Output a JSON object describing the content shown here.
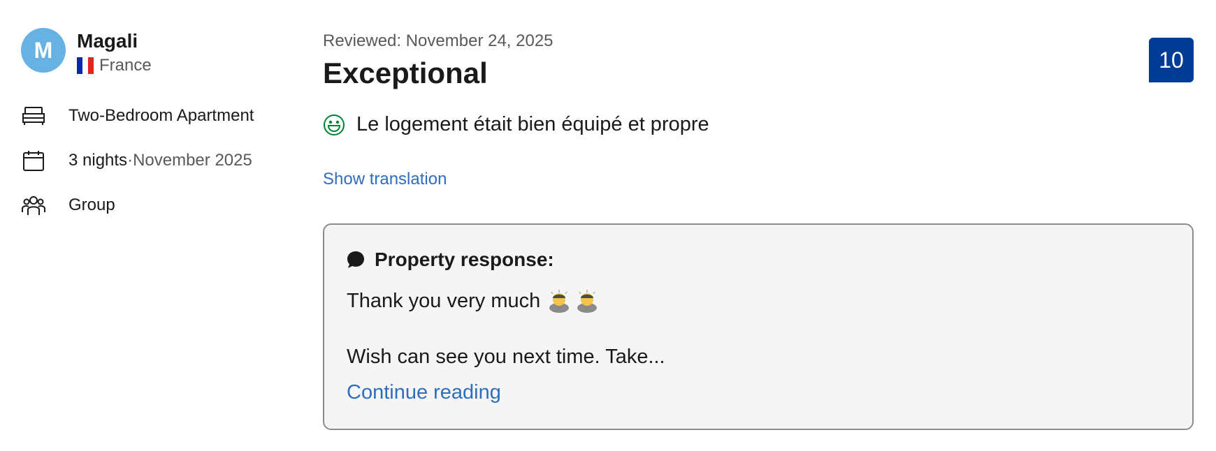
{
  "reviewer": {
    "avatar_letter": "M",
    "name": "Magali",
    "country": "France"
  },
  "stay": {
    "room": "Two-Bedroom Apartment",
    "nights": "3 nights",
    "separator": " · ",
    "month": "November 2025",
    "traveler_type": "Group"
  },
  "review": {
    "date_label": "Reviewed: November 24, 2025",
    "title": "Exceptional",
    "score": "10",
    "positive_text": "Le logement était bien équipé et propre",
    "show_translation": "Show translation"
  },
  "property_response": {
    "heading": "Property response:",
    "line1": "Thank you very much",
    "line2": "Wish can see you next time. Take...",
    "continue_label": "Continue reading"
  },
  "colors": {
    "avatar": "#68b1e3",
    "score_badge": "#003b95",
    "link": "#2f6dbf",
    "positive_icon": "#008234"
  }
}
